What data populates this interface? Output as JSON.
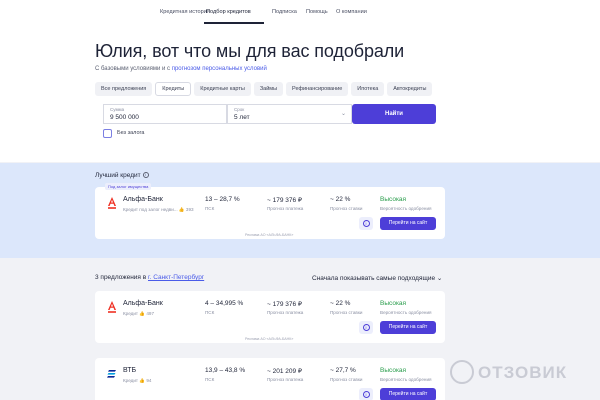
{
  "nav": {
    "items": [
      "Кредитная история",
      "Подбор кредитов",
      "Подписка",
      "Помощь",
      "О компании"
    ],
    "active": "Подбор кредитов"
  },
  "header": {
    "title": "Юлия, вот что мы для вас подобрали",
    "subtitle_pre": "С базовыми условиями и с",
    "subtitle_link": "прогнозом персональных условий"
  },
  "tabs": [
    "Все предложения",
    "Кредиты",
    "Кредитные карты",
    "Займы",
    "Рефинансирование",
    "Ипотека",
    "Автокредиты"
  ],
  "active_tab": "Кредиты",
  "search": {
    "amount_label": "Сумма",
    "amount_value": "9 500 000",
    "term_label": "Срок",
    "term_value": "5 лет",
    "find_button": "Найти",
    "no_collateral_label": "Без залога"
  },
  "best": {
    "heading": "Лучший кредит",
    "tag": "Под залог имущества",
    "bank": "Альфа-Банк",
    "sub": "Кредит под залог недви...",
    "likes": "393",
    "rate": "13 – 28,7 %",
    "rate_label": "ПСК",
    "payment": "~ 179 376 ₽",
    "payment_label": "Прогноз платежа",
    "pred_rate": "~ 22 %",
    "pred_rate_label": "Прогноз ставки",
    "probability": "Высокая",
    "probability_label": "Вероятность одобрения",
    "goto": "Перейти на сайт",
    "ad": "Реклама АО «АЛЬФА-БАНК»"
  },
  "offers": {
    "count_text": "3 предложения в",
    "city": "г. Санкт-Петербург",
    "sort": "Сначала показывать самые подходящие"
  },
  "cards": [
    {
      "bank": "Альфа-Банк",
      "sub": "Кредит",
      "likes": "497",
      "rate": "4 – 34,995 %",
      "rate_label": "ПСК",
      "payment": "~ 179 376 ₽",
      "payment_label": "Прогноз платежа",
      "pred_rate": "~ 22 %",
      "pred_rate_label": "Прогноз ставки",
      "probability": "Высокая",
      "probability_label": "Вероятность одобрения",
      "goto": "Перейти на сайт",
      "ad": "Реклама АО «АЛЬФА-БАНК»"
    },
    {
      "bank": "ВТБ",
      "sub": "Кредит",
      "likes": "94",
      "rate": "13,9 – 43,8 %",
      "rate_label": "ПСК",
      "payment": "~ 201 209 ₽",
      "payment_label": "Прогноз платежа",
      "pred_rate": "~ 27,7 %",
      "pred_rate_label": "Прогноз ставки",
      "probability": "Высокая",
      "probability_label": "Вероятность одобрения",
      "goto": "Перейти на сайт"
    }
  ],
  "watermark": "ОТЗОВИК",
  "colors": {
    "accent": "#4d3ed8",
    "approval": "#2a9d4c",
    "best_band": "#dce7fb",
    "alfa_red": "#ef3124",
    "vtb_blue": "#0a2896"
  }
}
